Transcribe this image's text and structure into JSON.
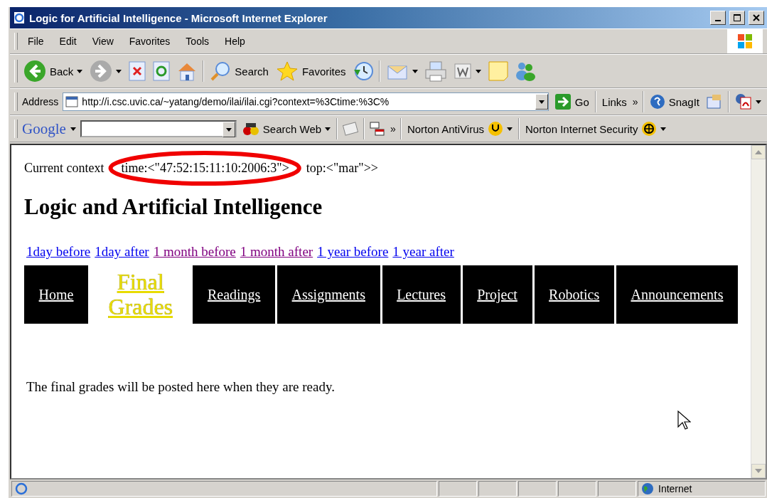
{
  "window": {
    "title": "Logic for Artificial Intelligence - Microsoft Internet Explorer"
  },
  "menu": [
    "File",
    "Edit",
    "View",
    "Favorites",
    "Tools",
    "Help"
  ],
  "toolbar": {
    "back": "Back",
    "search": "Search",
    "favorites": "Favorites"
  },
  "address_bar": {
    "label": "Address",
    "value": "http://i.csc.uvic.ca/~yatang/demo/ilai/ilai.cgi?context=%3Ctime:%3C%",
    "go": "Go",
    "links": "Links",
    "chevron": "»",
    "snagit": "SnagIt"
  },
  "google_bar": {
    "logo": "Google",
    "search_web": "Search Web",
    "chevron": "»",
    "antivirus": "Norton AntiVirus",
    "security": "Norton Internet Security"
  },
  "page": {
    "context": {
      "label": "Current context",
      "highlighted": "time:<\"47:52:15:11:10:2006:3\">",
      "rest": "top:<\"mar\">>"
    },
    "heading": "Logic and Artificial Intelligence",
    "date_links": [
      {
        "label": "1day before",
        "visited": false
      },
      {
        "label": "1day after",
        "visited": false
      },
      {
        "label": "1 month before",
        "visited": true
      },
      {
        "label": "1 month after",
        "visited": true
      },
      {
        "label": "1 year before",
        "visited": false
      },
      {
        "label": "1 year after",
        "visited": false
      }
    ],
    "nav": [
      {
        "label": "Home",
        "selected": false
      },
      {
        "label": "Final Grades",
        "selected": true
      },
      {
        "label": "Readings",
        "selected": false
      },
      {
        "label": "Assignments",
        "selected": false
      },
      {
        "label": "Lectures",
        "selected": false
      },
      {
        "label": "Project",
        "selected": false
      },
      {
        "label": "Robotics",
        "selected": false
      },
      {
        "label": "Announcements",
        "selected": false
      }
    ],
    "message": "The final grades will be posted here when they are ready."
  },
  "status_bar": {
    "zone": "Internet"
  }
}
